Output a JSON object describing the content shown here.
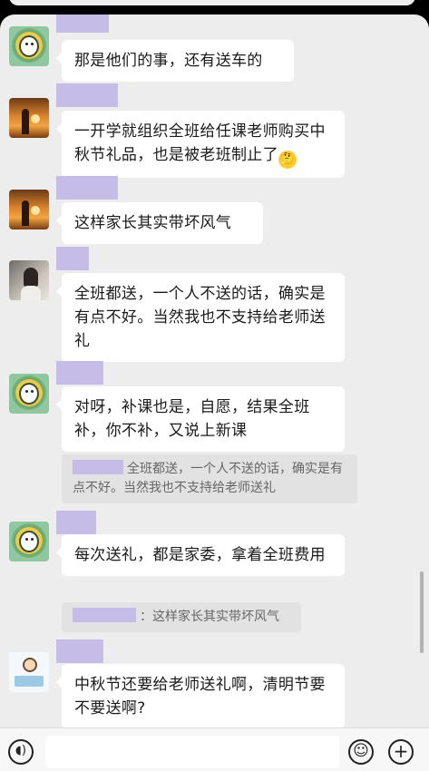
{
  "messages": [
    {
      "text": "那是他们的事，还有送车的"
    },
    {
      "text": "一开学就组织全班给任课老师购买中秋节礼品，也是被老班制止了",
      "emoji": "🤔"
    },
    {
      "text": "这样家长其实带坏风气"
    },
    {
      "text": "全班都送，一个人不送的话，确实是有点不好。当然我也不支持给老师送礼"
    },
    {
      "text": "对呀，补课也是，自愿，结果全班补，你不补，又说上新课",
      "quote": "全班都送，一个人不送的话，确实是有点不好。当然我也不支持给老师送礼"
    },
    {
      "text": "每次送礼，都是家委，拿着全班费用",
      "quote": "：这样家长其实带坏风气"
    },
    {
      "text": "中秋节还要给老师送礼啊，清明节要不要送啊?"
    }
  ],
  "input_bar": {
    "voice_icon": "voice-icon",
    "emoji_icon": "emoji-icon",
    "plus_icon": "plus-icon"
  },
  "colors": {
    "background": "#ededed",
    "bubble": "#ffffff",
    "quote": "#e2e2e2",
    "name_redaction": "#c5bde8"
  }
}
